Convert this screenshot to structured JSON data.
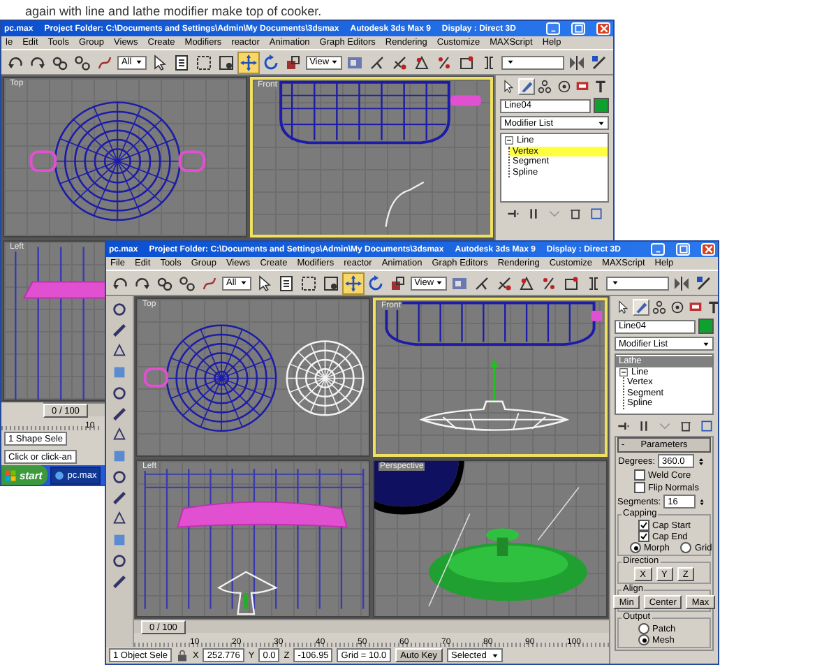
{
  "caption": "again with line and lathe modifier make top of cooker.",
  "windows": [
    {
      "title_bar": {
        "file": "pc.max",
        "project": "Project Folder: C:\\Documents and Settings\\Admin\\My Documents\\3dsmax",
        "app": "Autodesk 3ds Max 9",
        "display": "Display : Direct 3D"
      },
      "menu": [
        "le",
        "Edit",
        "Tools",
        "Group",
        "Views",
        "Create",
        "Modifiers",
        "reactor",
        "Animation",
        "Graph Editors",
        "Rendering",
        "Customize",
        "MAXScript",
        "Help"
      ],
      "toolbar": [
        {
          "kind": "undo",
          "selected": false
        },
        {
          "kind": "redo",
          "selected": false
        },
        {
          "kind": "link",
          "selected": false
        },
        {
          "kind": "unlink",
          "selected": false
        },
        {
          "kind": "bind",
          "selected": false
        },
        {
          "kind": "dropdown",
          "value": "All"
        },
        {
          "kind": "select",
          "selected": false
        },
        {
          "kind": "select-name",
          "selected": false
        },
        {
          "kind": "region",
          "selected": false
        },
        {
          "kind": "window",
          "selected": false
        },
        {
          "kind": "move",
          "selected": true
        },
        {
          "kind": "rotate",
          "selected": false
        },
        {
          "kind": "scale",
          "selected": false
        },
        {
          "kind": "dropdown",
          "value": "View"
        },
        {
          "kind": "pivot",
          "selected": false
        },
        {
          "kind": "manipulate",
          "selected": false
        },
        {
          "kind": "snap",
          "selected": false
        },
        {
          "kind": "angle-snap",
          "selected": false
        },
        {
          "kind": "percent-snap",
          "selected": false
        },
        {
          "kind": "spinner-snap",
          "selected": false
        },
        {
          "kind": "edit-named",
          "selected": false
        },
        {
          "kind": "dropdown"
        },
        {
          "kind": "mirror",
          "selected": false
        },
        {
          "kind": "align",
          "selected": false
        }
      ],
      "viewports": [
        {
          "label": "Top",
          "active": false,
          "kind": "pot-top"
        },
        {
          "label": "Front",
          "active": true,
          "kind": "pot-side"
        },
        {
          "label": "Left",
          "active": false,
          "kind": "lid-left-partial"
        }
      ],
      "command_panel": {
        "tabs": [
          {
            "kind": "create",
            "selected": false
          },
          {
            "kind": "modify",
            "selected": true
          },
          {
            "kind": "hierarchy",
            "selected": false
          },
          {
            "kind": "motion",
            "selected": false
          },
          {
            "kind": "display",
            "selected": false
          },
          {
            "kind": "utilities",
            "selected": false
          }
        ],
        "object_name": "Line04",
        "modifier_list": "Modifier List",
        "stack": [
          {
            "label": "Line",
            "selected": false,
            "children": [
              {
                "label": "Vertex",
                "selected": true
              },
              {
                "label": "Segment",
                "selected": false
              },
              {
                "label": "Spline",
                "selected": false
              }
            ]
          }
        ]
      },
      "timeline": {
        "position": "0 / 100",
        "level": 0
      },
      "ruler": [
        "10"
      ],
      "status": [
        {
          "kind": "field",
          "text": "1 Shape Sele"
        },
        {
          "kind": "field",
          "text": "Click or click-an"
        }
      ],
      "taskbar": {
        "start": "start",
        "tasks": [
          {
            "label": "pc.max",
            "selected": true
          }
        ]
      }
    },
    {
      "title_bar": {
        "file": "pc.max",
        "project": "Project Folder: C:\\Documents and Settings\\Admin\\My Documents\\3dsmax",
        "app": "Autodesk 3ds Max 9",
        "display": "Display : Direct 3D"
      },
      "menu": [
        "File",
        "Edit",
        "Tools",
        "Group",
        "Views",
        "Create",
        "Modifiers",
        "reactor",
        "Animation",
        "Graph Editors",
        "Rendering",
        "Customize",
        "MAXScript",
        "Help"
      ],
      "toolbar": [
        {
          "kind": "undo",
          "selected": false
        },
        {
          "kind": "redo",
          "selected": false
        },
        {
          "kind": "link",
          "selected": false
        },
        {
          "kind": "unlink",
          "selected": false
        },
        {
          "kind": "bind",
          "selected": false
        },
        {
          "kind": "dropdown",
          "value": "All"
        },
        {
          "kind": "select",
          "selected": false
        },
        {
          "kind": "select-name",
          "selected": false
        },
        {
          "kind": "region",
          "selected": false
        },
        {
          "kind": "window",
          "selected": false
        },
        {
          "kind": "move",
          "selected": true
        },
        {
          "kind": "rotate",
          "selected": false
        },
        {
          "kind": "scale",
          "selected": false
        },
        {
          "kind": "dropdown",
          "value": "View"
        },
        {
          "kind": "pivot",
          "selected": false
        },
        {
          "kind": "manipulate",
          "selected": false
        },
        {
          "kind": "snap",
          "selected": false
        },
        {
          "kind": "angle-snap",
          "selected": false
        },
        {
          "kind": "percent-snap",
          "selected": false
        },
        {
          "kind": "spinner-snap",
          "selected": false
        },
        {
          "kind": "edit-named",
          "selected": false
        },
        {
          "kind": "dropdown"
        },
        {
          "kind": "mirror",
          "selected": false
        },
        {
          "kind": "align",
          "selected": false
        }
      ],
      "side_toolbar": true,
      "viewports": [
        {
          "label": "Top",
          "active": false,
          "kind": "pot-lid-top"
        },
        {
          "label": "Front",
          "active": true,
          "kind": "lid-front"
        },
        {
          "label": "Left",
          "active": false,
          "kind": "lid-left"
        },
        {
          "label": "Perspective",
          "active": false,
          "kind": "perspective"
        }
      ],
      "command_panel": {
        "tabs": [
          {
            "kind": "create",
            "selected": false
          },
          {
            "kind": "modify",
            "selected": true
          },
          {
            "kind": "hierarchy",
            "selected": false
          },
          {
            "kind": "motion",
            "selected": false
          },
          {
            "kind": "display",
            "selected": false
          },
          {
            "kind": "utilities",
            "selected": false
          }
        ],
        "object_name": "Line04",
        "modifier_list": "Modifier List",
        "stack": [
          {
            "label": "Lathe",
            "selected": true
          },
          {
            "label": "Line",
            "selected": false,
            "children": [
              {
                "label": "Vertex",
                "selected": false
              },
              {
                "label": "Segment",
                "selected": false
              },
              {
                "label": "Spline",
                "selected": false
              }
            ]
          }
        ],
        "parameters": {
          "sign": "-",
          "title": "Parameters",
          "controls": [
            {
              "kind": "spinner",
              "label": "Degrees:",
              "value": "360.0"
            },
            {
              "kind": "checkbox",
              "label": "Weld Core",
              "checked": false
            },
            {
              "kind": "checkbox",
              "label": "Flip Normals",
              "checked": false
            },
            {
              "kind": "spinner",
              "label": "Segments:",
              "value": "16"
            },
            {
              "kind": "group",
              "title": "Capping",
              "controls": [
                {
                  "kind": "checkbox",
                  "label": "Cap Start",
                  "checked": true
                },
                {
                  "kind": "checkbox",
                  "label": "Cap End",
                  "checked": true
                },
                {
                  "kind": "radio-row",
                  "options": [
                    {
                      "label": "Morph",
                      "selected": true
                    },
                    {
                      "label": "Grid",
                      "selected": false
                    }
                  ]
                }
              ]
            },
            {
              "kind": "group",
              "title": "Direction",
              "controls": [
                {
                  "kind": "buttons",
                  "labels": [
                    "X",
                    "Y",
                    "Z"
                  ]
                }
              ]
            },
            {
              "kind": "group",
              "title": "Align",
              "controls": [
                {
                  "kind": "buttons",
                  "labels": [
                    "Min",
                    "Center",
                    "Max"
                  ]
                }
              ]
            },
            {
              "kind": "group",
              "title": "Output",
              "controls": [
                {
                  "kind": "radio",
                  "label": "Patch",
                  "selected": false
                },
                {
                  "kind": "radio",
                  "label": "Mesh",
                  "selected": true
                }
              ]
            }
          ]
        }
      },
      "timeline": {
        "position": "0 / 100",
        "level": 0
      },
      "ruler": [
        "10",
        "20",
        "30",
        "40",
        "50",
        "60",
        "70",
        "80",
        "90",
        "100"
      ],
      "status": [
        {
          "kind": "field",
          "text": "1 Object Sele"
        },
        {
          "kind": "lock"
        },
        {
          "kind": "label",
          "text": "X"
        },
        {
          "kind": "field",
          "text": "252.776"
        },
        {
          "kind": "label",
          "text": "Y"
        },
        {
          "kind": "field",
          "text": "0.0"
        },
        {
          "kind": "label",
          "text": "Z"
        },
        {
          "kind": "field",
          "text": "-106.95"
        },
        {
          "kind": "field",
          "text": "Grid = 10.0"
        },
        {
          "kind": "button",
          "text": "Auto Key"
        },
        {
          "kind": "dropdown",
          "text": "Selected"
        }
      ]
    }
  ]
}
